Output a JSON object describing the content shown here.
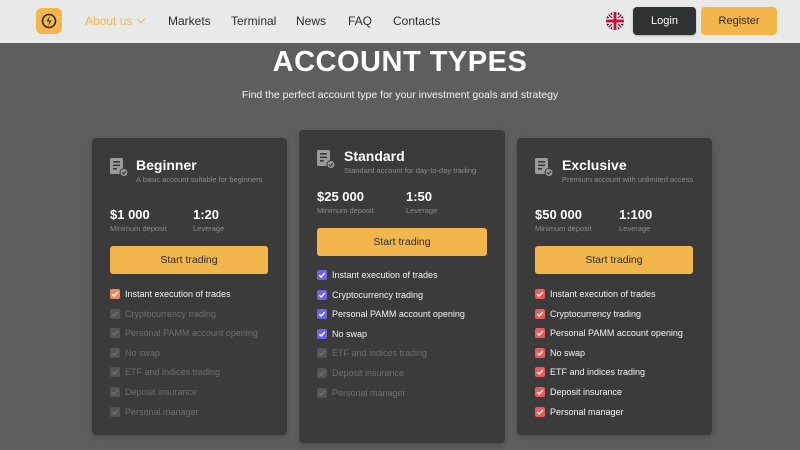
{
  "nav": {
    "items": [
      {
        "key": "about",
        "label": "About us",
        "active": true
      },
      {
        "key": "markets",
        "label": "Markets"
      },
      {
        "key": "terminal",
        "label": "Terminal"
      },
      {
        "key": "news",
        "label": "News"
      },
      {
        "key": "faq",
        "label": "FAQ"
      },
      {
        "key": "contacts",
        "label": "Contacts"
      }
    ],
    "login_label": "Login",
    "register_label": "Register",
    "language_icon": "uk-flag-icon"
  },
  "header": {
    "title": "ACCOUNT TYPES",
    "subtitle": "Find the perfect account type for your investment goals and strategy"
  },
  "colors": {
    "accent": "#f3b64d",
    "beginner_check": "#f08a5d",
    "standard_check": "#6c63e8",
    "exclusive_check": "#ec5a5a"
  },
  "cards": [
    {
      "name": "Beginner",
      "description": "A basic account suitable for beginners",
      "min_deposit": "$1 000",
      "min_deposit_label": "Minimum deposit",
      "leverage": "1:20",
      "leverage_label": "Leverage",
      "cta": "Start trading",
      "features": [
        {
          "label": "Instant execution of trades",
          "enabled": true
        },
        {
          "label": "Cryptocurrency trading",
          "enabled": false
        },
        {
          "label": "Personal PAMM account opening",
          "enabled": false
        },
        {
          "label": "No swap",
          "enabled": false
        },
        {
          "label": "ETF and indices trading",
          "enabled": false
        },
        {
          "label": "Deposit insurance",
          "enabled": false
        },
        {
          "label": "Personal manager",
          "enabled": false
        }
      ]
    },
    {
      "name": "Standard",
      "description": "Standard account for day-to-day trading",
      "min_deposit": "$25 000",
      "min_deposit_label": "Minimum deposit",
      "leverage": "1:50",
      "leverage_label": "Leverage",
      "cta": "Start trading",
      "features": [
        {
          "label": "Instant execution of trades",
          "enabled": true
        },
        {
          "label": "Cryptocurrency trading",
          "enabled": true
        },
        {
          "label": "Personal PAMM account opening",
          "enabled": true
        },
        {
          "label": "No swap",
          "enabled": true
        },
        {
          "label": "ETF and indices trading",
          "enabled": false
        },
        {
          "label": "Deposit insurance",
          "enabled": false
        },
        {
          "label": "Personal manager",
          "enabled": false
        }
      ]
    },
    {
      "name": "Exclusive",
      "description": "Premium account with unlimited access",
      "min_deposit": "$50 000",
      "min_deposit_label": "Minimum deposit",
      "leverage": "1:100",
      "leverage_label": "Leverage",
      "cta": "Start trading",
      "features": [
        {
          "label": "Instant execution of trades",
          "enabled": true
        },
        {
          "label": "Cryptocurrency trading",
          "enabled": true
        },
        {
          "label": "Personal PAMM account opening",
          "enabled": true
        },
        {
          "label": "No swap",
          "enabled": true
        },
        {
          "label": "ETF and indices trading",
          "enabled": true
        },
        {
          "label": "Deposit insurance",
          "enabled": true
        },
        {
          "label": "Personal manager",
          "enabled": true
        }
      ]
    }
  ]
}
